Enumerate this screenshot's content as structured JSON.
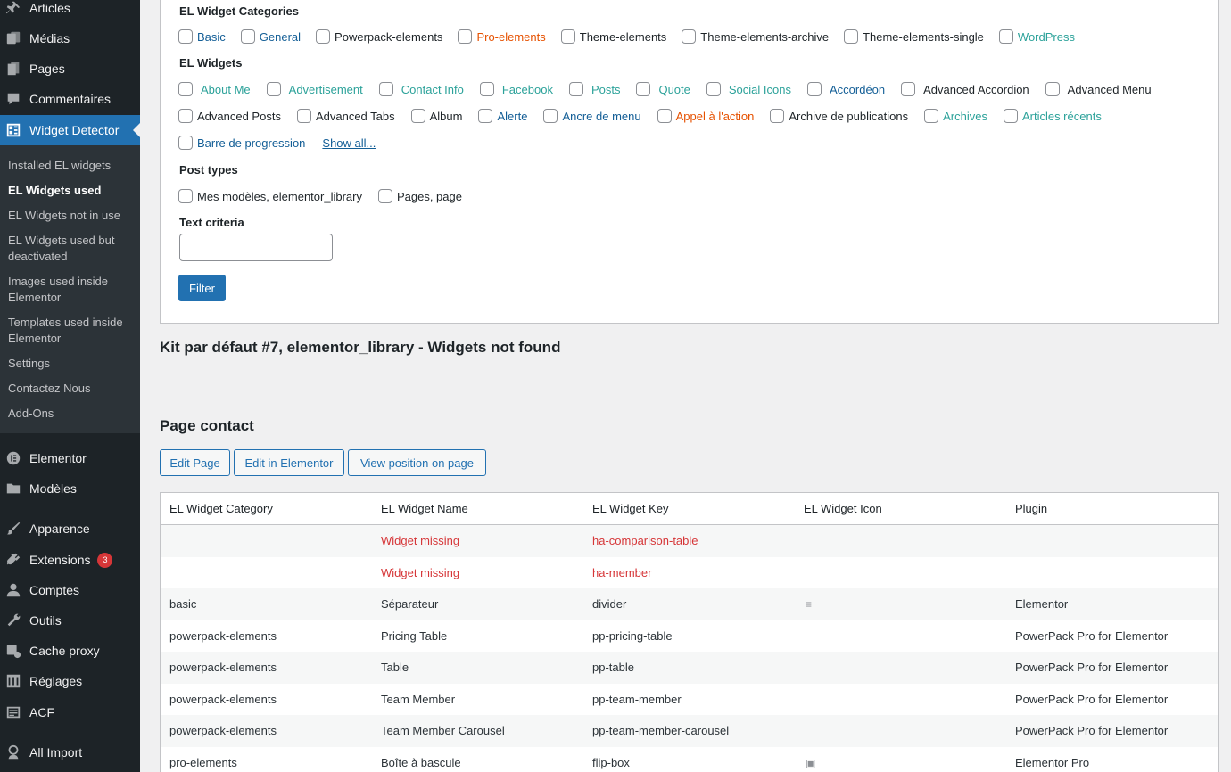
{
  "sidebar": {
    "top_items": [
      {
        "label": "Articles",
        "icon": "pin-icon"
      },
      {
        "label": "Médias",
        "icon": "media-icon"
      },
      {
        "label": "Pages",
        "icon": "pages-icon"
      },
      {
        "label": "Commentaires",
        "icon": "comments-icon"
      },
      {
        "label": "Widget Detector",
        "icon": "widget-detector-icon"
      }
    ],
    "submenu": [
      "Installed EL widgets",
      "EL Widgets used",
      "EL Widgets not in use",
      "EL Widgets used but deactivated",
      "Images used inside Elementor",
      "Templates used inside Elementor",
      "Settings",
      "Contactez Nous",
      "Add-Ons"
    ],
    "bottom_items": [
      {
        "label": "Elementor",
        "icon": "elementor-icon"
      },
      {
        "label": "Modèles",
        "icon": "folder-icon"
      },
      {
        "label": "Apparence",
        "icon": "brush-icon"
      },
      {
        "label": "Extensions",
        "icon": "plugin-icon",
        "badge": "3"
      },
      {
        "label": "Comptes",
        "icon": "user-icon"
      },
      {
        "label": "Outils",
        "icon": "wrench-icon"
      },
      {
        "label": "Cache proxy",
        "icon": "cache-icon"
      },
      {
        "label": "Réglages",
        "icon": "settings-icon"
      },
      {
        "label": "ACF",
        "icon": "acf-icon"
      },
      {
        "label": "All Import",
        "icon": "import-icon"
      }
    ]
  },
  "filter": {
    "categories_label": "EL Widget Categories",
    "categories": [
      "Basic",
      "General",
      "Powerpack-elements",
      "Pro-elements",
      "Theme-elements",
      "Theme-elements-archive",
      "Theme-elements-single",
      "WordPress"
    ],
    "widgets_label": "EL Widgets",
    "widgets_row1": [
      "About Me",
      "Advertisement",
      "Contact Info",
      "Facebook",
      "Posts",
      "Quote",
      "Social Icons",
      "Accordéon",
      "Advanced Accordion",
      "Advanced Menu"
    ],
    "widgets_row2": [
      "Advanced Posts",
      "Advanced Tabs",
      "Album",
      "Alerte",
      "Ancre de menu",
      "Appel à l'action",
      "Archive de publications",
      "Archives",
      "Articles récents"
    ],
    "widgets_row3": [
      "Barre de progression"
    ],
    "show_all": "Show all...",
    "post_types_label": "Post types",
    "post_types": [
      "Mes modèles, elementor_library",
      "Pages, page"
    ],
    "text_criteria_label": "Text criteria",
    "text_criteria_value": "",
    "filter_button": "Filter"
  },
  "kit_heading": "Kit par défaut #7, elementor_library - Widgets not found",
  "page_heading": "Page contact",
  "actions": {
    "edit_page": "Edit Page",
    "edit_in_elementor": "Edit in Elementor",
    "view_position": "View position on page"
  },
  "table": {
    "headers": [
      "EL Widget Category",
      "EL Widget Name",
      "EL Widget Key",
      "EL Widget Icon",
      "Plugin"
    ],
    "rows": [
      {
        "category": "",
        "name": "Widget missing",
        "key": "ha-comparison-table",
        "icon": "",
        "plugin": "",
        "missing": true
      },
      {
        "category": "",
        "name": "Widget missing",
        "key": "ha-member",
        "icon": "",
        "plugin": "",
        "missing": true
      },
      {
        "category": "basic",
        "name": "Séparateur",
        "key": "divider",
        "icon": "divider-icon",
        "plugin": "Elementor"
      },
      {
        "category": "powerpack-elements",
        "name": "Pricing Table",
        "key": "pp-pricing-table",
        "icon": "",
        "plugin": "PowerPack Pro for Elementor"
      },
      {
        "category": "powerpack-elements",
        "name": "Table",
        "key": "pp-table",
        "icon": "",
        "plugin": "PowerPack Pro for Elementor"
      },
      {
        "category": "powerpack-elements",
        "name": "Team Member",
        "key": "pp-team-member",
        "icon": "",
        "plugin": "PowerPack Pro for Elementor"
      },
      {
        "category": "powerpack-elements",
        "name": "Team Member Carousel",
        "key": "pp-team-member-carousel",
        "icon": "",
        "plugin": "PowerPack Pro for Elementor"
      },
      {
        "category": "pro-elements",
        "name": "Boîte à bascule",
        "key": "flip-box",
        "icon": "flip-box-icon",
        "plugin": "Elementor Pro"
      }
    ]
  },
  "colors": {
    "sidebar_bg": "#1d2327",
    "submenu_bg": "#2c3338",
    "accent": "#2271b1",
    "missing": "#d63638",
    "badge": "#d63638"
  }
}
